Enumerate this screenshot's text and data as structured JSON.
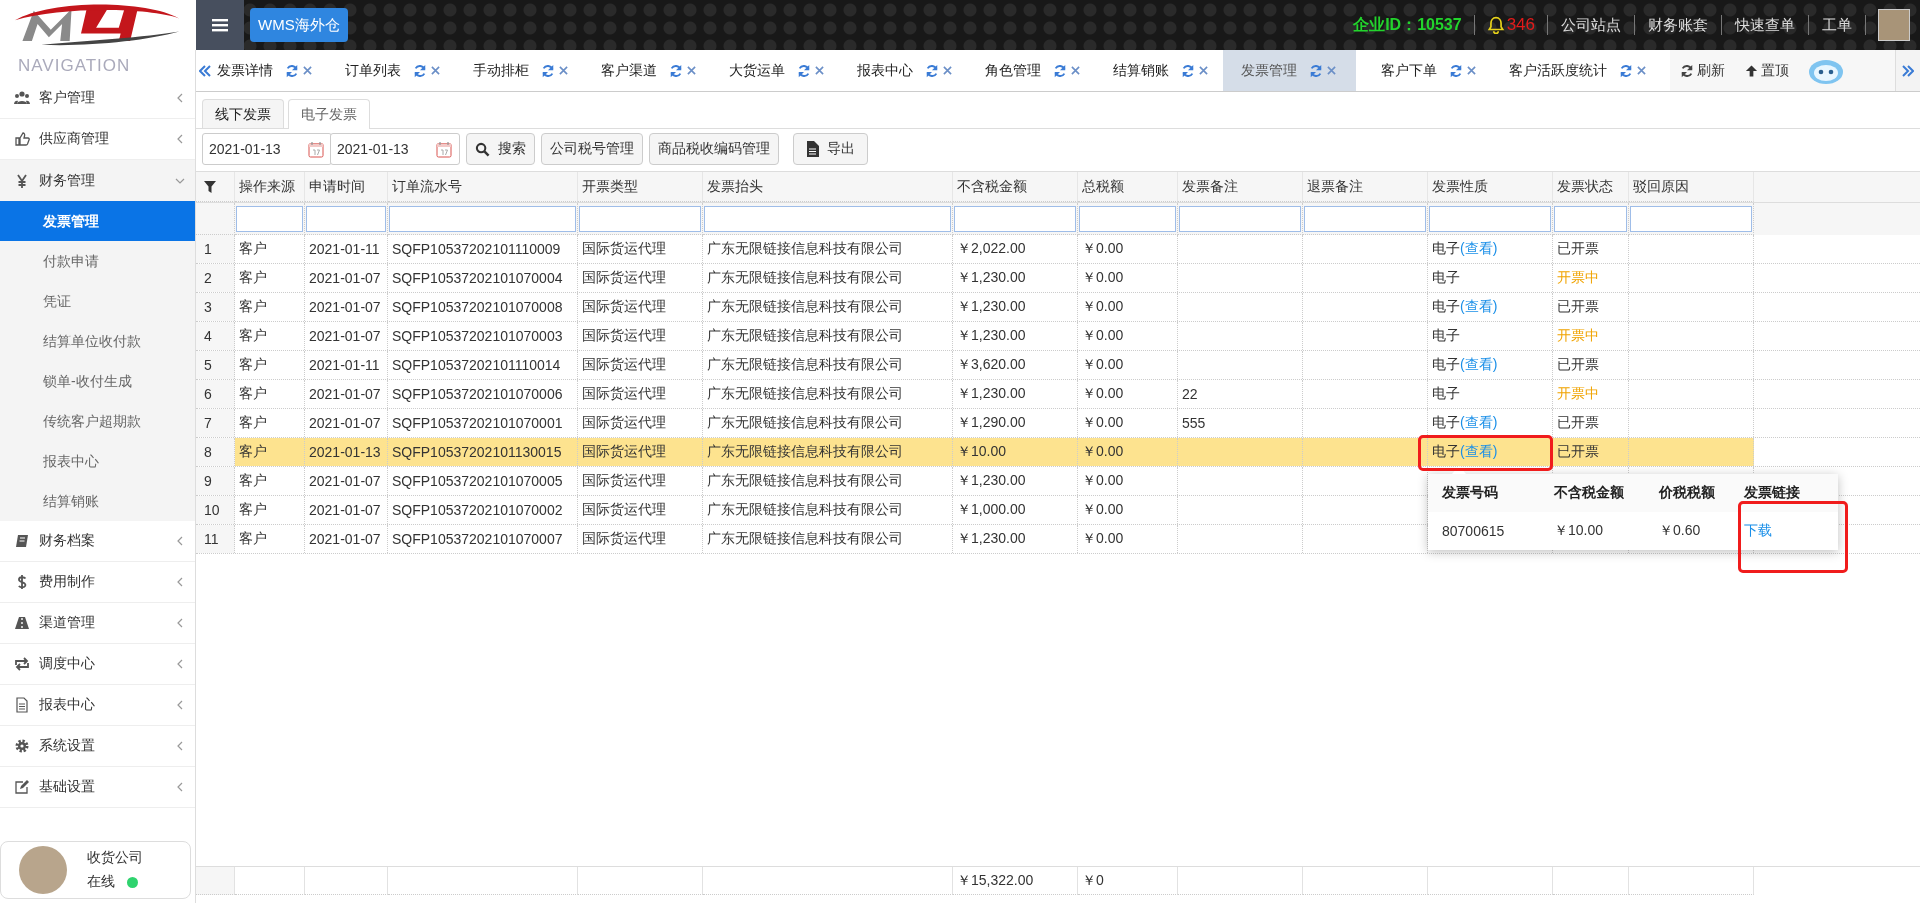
{
  "header": {
    "app_button": "WMS海外仓",
    "company_id": "企业ID：10537",
    "notification_count": "346",
    "links": [
      "公司站点",
      "财务账套",
      "快速查单",
      "工单"
    ]
  },
  "sidebar": {
    "title": "NAVIGATION",
    "items": [
      {
        "label": "客户管理",
        "kind": "users",
        "expanded": false
      },
      {
        "label": "供应商管理",
        "kind": "thumb",
        "expanded": false
      },
      {
        "label": "财务管理",
        "kind": "yen",
        "expanded": true,
        "children": [
          {
            "label": "发票管理",
            "selected": true
          },
          {
            "label": "付款申请",
            "selected": false
          },
          {
            "label": "凭证",
            "selected": false
          },
          {
            "label": "结算单位收付款",
            "selected": false
          },
          {
            "label": "锁单-收付生成",
            "selected": false
          },
          {
            "label": "传统客户超期款",
            "selected": false
          },
          {
            "label": "报表中心",
            "selected": false
          },
          {
            "label": "结算销账",
            "selected": false
          }
        ]
      },
      {
        "label": "财务档案",
        "kind": "book",
        "expanded": false
      },
      {
        "label": "费用制作",
        "kind": "dollar",
        "expanded": false
      },
      {
        "label": "渠道管理",
        "kind": "road",
        "expanded": false
      },
      {
        "label": "调度中心",
        "kind": "swap",
        "expanded": false
      },
      {
        "label": "报表中心",
        "kind": "file",
        "expanded": false
      },
      {
        "label": "系统设置",
        "kind": "gear",
        "expanded": false
      },
      {
        "label": "基础设置",
        "kind": "edit",
        "expanded": false
      }
    ],
    "user": {
      "name": "收货公司",
      "status": "在线",
      "online": true
    }
  },
  "page_tabs": {
    "items": [
      {
        "label": "发票详情",
        "selected": false
      },
      {
        "label": "订单列表",
        "selected": false
      },
      {
        "label": "手动排柜",
        "selected": false
      },
      {
        "label": "客户渠道",
        "selected": false
      },
      {
        "label": "大货运单",
        "selected": false
      },
      {
        "label": "报表中心",
        "selected": false
      },
      {
        "label": "角色管理",
        "selected": false
      },
      {
        "label": "结算销账",
        "selected": false
      },
      {
        "label": "发票管理",
        "selected": true
      },
      {
        "label": "客户下单",
        "selected": false
      },
      {
        "label": "客户活跃度统计",
        "selected": false
      }
    ],
    "actions": [
      {
        "kind": "refresh",
        "label": "刷新"
      },
      {
        "kind": "pin",
        "label": "置顶"
      }
    ]
  },
  "sub_tabs": [
    {
      "label": "线下发票",
      "selected": false
    },
    {
      "label": "电子发票",
      "selected": true
    }
  ],
  "toolbar": {
    "date_from": "2021-01-13",
    "date_to": "2021-01-13",
    "buttons": [
      {
        "kind": "search",
        "label": "搜索"
      },
      {
        "kind": "plain",
        "label": "公司税号管理"
      },
      {
        "kind": "plain",
        "label": "商品税收编码管理"
      },
      {
        "kind": "export",
        "label": "导出"
      }
    ]
  },
  "table": {
    "columns": [
      "操作来源",
      "申请时间",
      "订单流水号",
      "开票类型",
      "发票抬头",
      "不含税金额",
      "总税额",
      "发票备注",
      "退票备注",
      "发票性质",
      "发票状态",
      "驳回原因"
    ],
    "rows": [
      {
        "no": "1",
        "source": "客户",
        "date": "2021-01-11",
        "order_no": "SQFP10537202101110009",
        "type": "国际货运代理",
        "title": "广东无限链接信息科技有限公司",
        "amount": "￥2,022.00",
        "tax": "￥0.00",
        "nature": "电子",
        "view_link": "(查看)",
        "status": "已开票",
        "in_progress": false,
        "selected": false
      },
      {
        "no": "2",
        "source": "客户",
        "date": "2021-01-07",
        "order_no": "SQFP10537202101070004",
        "type": "国际货运代理",
        "title": "广东无限链接信息科技有限公司",
        "amount": "￥1,230.00",
        "tax": "￥0.00",
        "nature": "电子",
        "status": "开票中",
        "in_progress": true,
        "selected": false
      },
      {
        "no": "3",
        "source": "客户",
        "date": "2021-01-07",
        "order_no": "SQFP10537202101070008",
        "type": "国际货运代理",
        "title": "广东无限链接信息科技有限公司",
        "amount": "￥1,230.00",
        "tax": "￥0.00",
        "nature": "电子",
        "view_link": "(查看)",
        "status": "已开票",
        "in_progress": false,
        "selected": false
      },
      {
        "no": "4",
        "source": "客户",
        "date": "2021-01-07",
        "order_no": "SQFP10537202101070003",
        "type": "国际货运代理",
        "title": "广东无限链接信息科技有限公司",
        "amount": "￥1,230.00",
        "tax": "￥0.00",
        "nature": "电子",
        "status": "开票中",
        "in_progress": true,
        "selected": false
      },
      {
        "no": "5",
        "source": "客户",
        "date": "2021-01-11",
        "order_no": "SQFP10537202101110014",
        "type": "国际货运代理",
        "title": "广东无限链接信息科技有限公司",
        "amount": "￥3,620.00",
        "tax": "￥0.00",
        "nature": "电子",
        "view_link": "(查看)",
        "status": "已开票",
        "in_progress": false,
        "selected": false
      },
      {
        "no": "6",
        "source": "客户",
        "date": "2021-01-07",
        "order_no": "SQFP10537202101070006",
        "type": "国际货运代理",
        "title": "广东无限链接信息科技有限公司",
        "amount": "￥1,230.00",
        "tax": "￥0.00",
        "invoice_note": "22",
        "nature": "电子",
        "status": "开票中",
        "in_progress": true,
        "selected": false
      },
      {
        "no": "7",
        "source": "客户",
        "date": "2021-01-07",
        "order_no": "SQFP10537202101070001",
        "type": "国际货运代理",
        "title": "广东无限链接信息科技有限公司",
        "amount": "￥1,290.00",
        "tax": "￥0.00",
        "invoice_note": "555",
        "nature": "电子",
        "view_link": "(查看)",
        "status": "已开票",
        "in_progress": false,
        "selected": false
      },
      {
        "no": "8",
        "source": "客户",
        "date": "2021-01-13",
        "order_no": "SQFP10537202101130015",
        "type": "国际货运代理",
        "title": "广东无限链接信息科技有限公司",
        "amount": "￥10.00",
        "tax": "￥0.00",
        "nature": "电子",
        "view_link": "(查看)",
        "status": "已开票",
        "in_progress": false,
        "selected": true
      },
      {
        "no": "9",
        "source": "客户",
        "date": "2021-01-07",
        "order_no": "SQFP10537202101070005",
        "type": "国际货运代理",
        "title": "广东无限链接信息科技有限公司",
        "amount": "￥1,230.00",
        "tax": "￥0.00",
        "selected": false
      },
      {
        "no": "10",
        "source": "客户",
        "date": "2021-01-07",
        "order_no": "SQFP10537202101070002",
        "type": "国际货运代理",
        "title": "广东无限链接信息科技有限公司",
        "amount": "￥1,000.00",
        "tax": "￥0.00",
        "selected": false
      },
      {
        "no": "11",
        "source": "客户",
        "date": "2021-01-07",
        "order_no": "SQFP10537202101070007",
        "type": "国际货运代理",
        "title": "广东无限链接信息科技有限公司",
        "amount": "￥1,230.00",
        "tax": "￥0.00",
        "selected": false
      }
    ],
    "footer": {
      "amount": "￥15,322.00",
      "tax": "￥0"
    }
  },
  "popup": {
    "highlighted": true,
    "columns": [
      "发票号码",
      "不含税金额",
      "价税税额",
      "发票链接"
    ],
    "rows": [
      {
        "number": "80700615",
        "amount": "￥10.00",
        "tax": "￥0.60",
        "link": "下载"
      }
    ]
  }
}
